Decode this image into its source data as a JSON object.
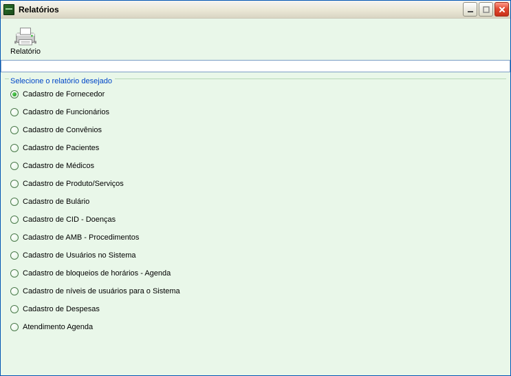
{
  "window": {
    "title": "Relatórios"
  },
  "toolbar": {
    "report_btn_label": "Relatório"
  },
  "input_value": "",
  "group": {
    "legend": "Selecione o relatório desejado"
  },
  "options": [
    {
      "label": "Cadastro de Fornecedor",
      "selected": true
    },
    {
      "label": "Cadastro de Funcionários",
      "selected": false
    },
    {
      "label": "Cadastro de Convênios",
      "selected": false
    },
    {
      "label": "Cadastro de Pacientes",
      "selected": false
    },
    {
      "label": "Cadastro de Médicos",
      "selected": false
    },
    {
      "label": "Cadastro de Produto/Serviços",
      "selected": false
    },
    {
      "label": "Cadastro de Bulário",
      "selected": false
    },
    {
      "label": "Cadastro de CID - Doenças",
      "selected": false
    },
    {
      "label": "Cadastro de AMB - Procedimentos",
      "selected": false
    },
    {
      "label": "Cadastro de Usuários no Sistema",
      "selected": false
    },
    {
      "label": "Cadastro de bloqueios de horários - Agenda",
      "selected": false
    },
    {
      "label": "Cadastro de níveis de usuários para o Sistema",
      "selected": false
    },
    {
      "label": "Cadastro de Despesas",
      "selected": false
    },
    {
      "label": "Atendimento Agenda",
      "selected": false
    }
  ]
}
